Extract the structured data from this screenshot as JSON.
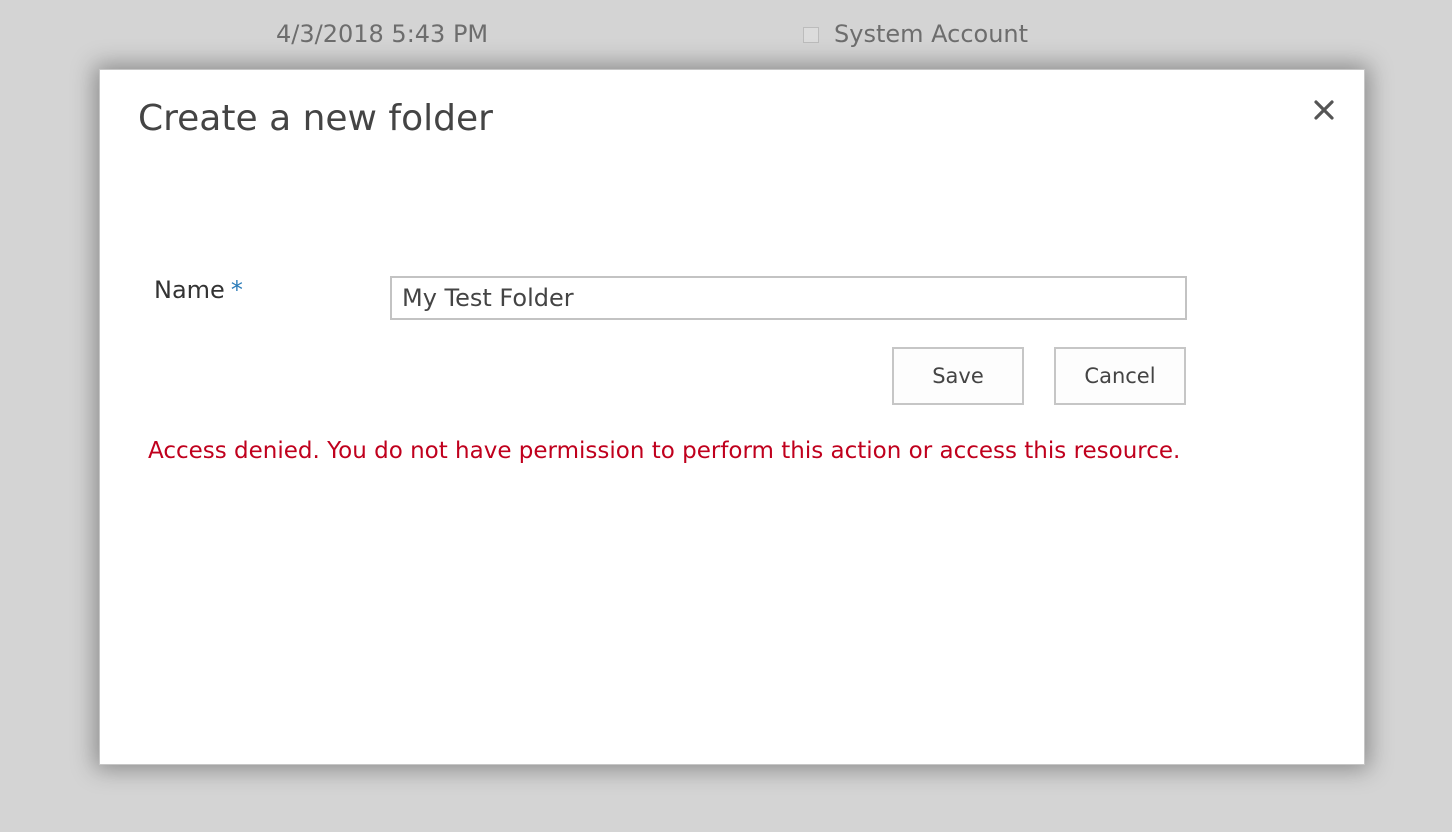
{
  "background_row": {
    "modified_date": "4/3/2018 5:43 PM",
    "modified_by": "System Account"
  },
  "dialog": {
    "title": "Create a new folder",
    "close_icon": "close-icon",
    "form": {
      "name_label": "Name",
      "required_marker": "*",
      "name_value": "My Test Folder"
    },
    "buttons": {
      "save_label": "Save",
      "cancel_label": "Cancel"
    },
    "error_message": "Access denied. You do not have permission to perform this action or access this resource."
  },
  "colors": {
    "error": "#c0001d",
    "required_accent": "#2a7bb8",
    "overlay": "#d4d4d4"
  }
}
